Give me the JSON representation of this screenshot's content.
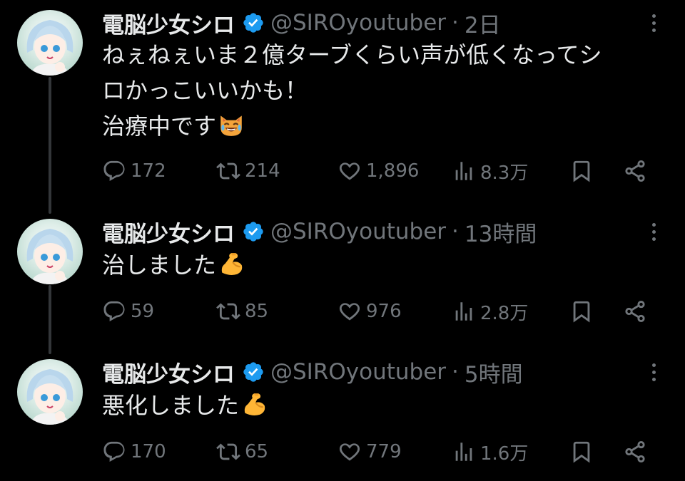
{
  "tweets": [
    {
      "name": "電脳少女シロ",
      "handle": "@SIROyoutuber",
      "separator": "·",
      "time": "2日",
      "lines": [
        "ねぇねぇいま２億ターブくらい声が低くなってシ",
        "ロかっこいいかも！",
        "治療中です"
      ],
      "emoji": "laughing-cat-emoji",
      "replies": "172",
      "reposts": "214",
      "likes": "1,896",
      "views": "8.3万"
    },
    {
      "name": "電脳少女シロ",
      "handle": "@SIROyoutuber",
      "separator": "·",
      "time": "13時間",
      "lines": [
        "治しました"
      ],
      "emoji": "flexed-biceps-emoji",
      "replies": "59",
      "reposts": "85",
      "likes": "976",
      "views": "2.8万"
    },
    {
      "name": "電脳少女シロ",
      "handle": "@SIROyoutuber",
      "separator": "·",
      "time": "5時間",
      "lines": [
        "悪化しました"
      ],
      "emoji": "flexed-biceps-emoji",
      "replies": "170",
      "reposts": "65",
      "likes": "779",
      "views": "1.6万"
    }
  ],
  "colors": {
    "background": "#000000",
    "text": "#e7e9ea",
    "muted": "#71767b",
    "verified": "#1d9bf0",
    "thread_line": "#333639"
  }
}
